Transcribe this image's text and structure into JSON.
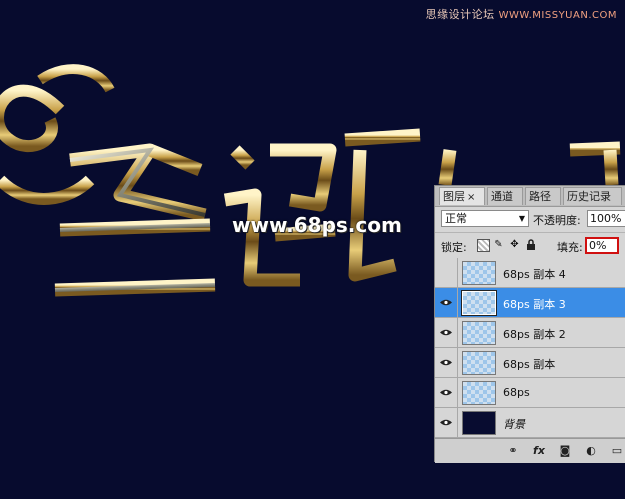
{
  "watermark": {
    "text": "思缘设计论坛",
    "url": "WWW.MISSYUAN.COM"
  },
  "artwork": {
    "url_text": "www.68ps.com",
    "background_color": "#070b2e",
    "text_color": "#d8b060"
  },
  "panel": {
    "tabs": [
      {
        "label": "图层",
        "active": true,
        "close": "×"
      },
      {
        "label": "通道"
      },
      {
        "label": "路径"
      },
      {
        "label": "历史记录"
      }
    ],
    "blend_mode": "正常",
    "opacity_label": "不透明度:",
    "opacity_value": "100%",
    "lock_label": "锁定:",
    "fill_label": "填充:",
    "fill_value": "0%",
    "layers": [
      {
        "name": "68ps 副本 4",
        "visible": false,
        "selected": false
      },
      {
        "name": "68ps 副本 3",
        "visible": true,
        "selected": true
      },
      {
        "name": "68ps 副本 2",
        "visible": true,
        "selected": false
      },
      {
        "name": "68ps  副本",
        "visible": true,
        "selected": false
      },
      {
        "name": "68ps",
        "visible": true,
        "selected": false
      },
      {
        "name": "背景",
        "visible": true,
        "selected": false
      }
    ],
    "selected_color": "#3b8de6",
    "highlight_color": "#d01010"
  }
}
